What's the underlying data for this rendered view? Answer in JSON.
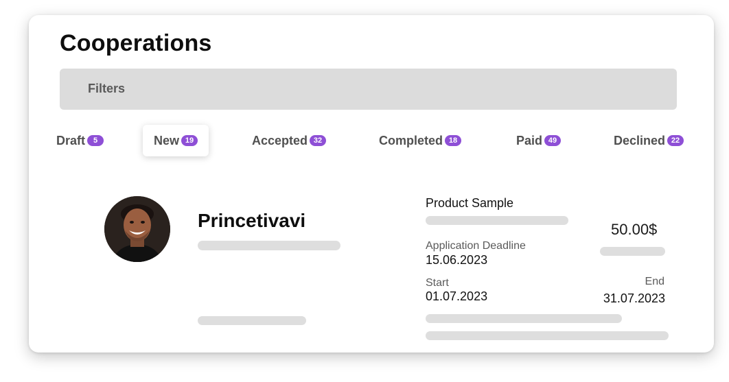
{
  "page": {
    "title": "Cooperations"
  },
  "filters": {
    "label": "Filters"
  },
  "tabs": [
    {
      "label": "Draft",
      "count": "5"
    },
    {
      "label": "New",
      "count": "19"
    },
    {
      "label": "Accepted",
      "count": "32"
    },
    {
      "label": "Completed",
      "count": "18"
    },
    {
      "label": "Paid",
      "count": "49"
    },
    {
      "label": "Declined",
      "count": "22"
    }
  ],
  "active_tab": "New",
  "cooperation": {
    "creator_name": "Princetivavi",
    "product_title": "Product Sample",
    "price": "50.00$",
    "application_deadline_label": "Application Deadline",
    "application_deadline": "15.06.2023",
    "start_label": "Start",
    "start_date": "01.07.2023",
    "end_label": "End",
    "end_date": "31.07.2023"
  },
  "colors": {
    "badge": "#8e4fd6",
    "filters_bg": "#dcdcdc",
    "skeleton": "#dedede"
  }
}
